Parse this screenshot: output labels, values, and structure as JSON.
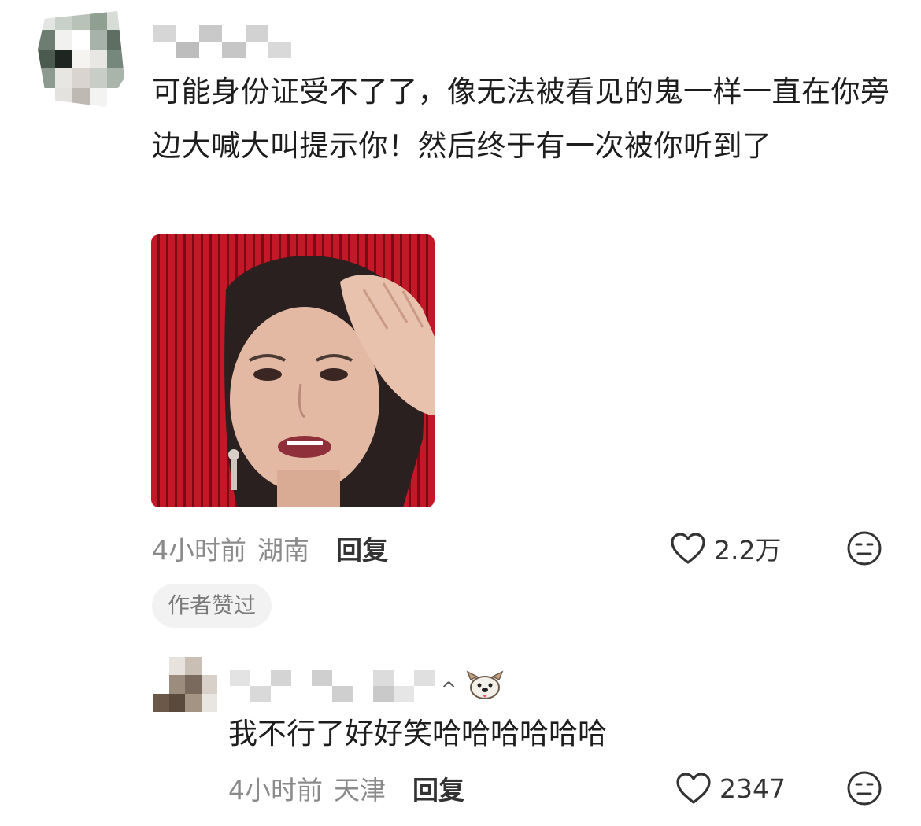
{
  "colors": {
    "text_primary": "#1d1d1d",
    "text_meta": "#8a8a8a",
    "reply_link": "#333333",
    "badge_bg": "#f2f2f2",
    "photo_red": "#c21828"
  },
  "comment": {
    "avatar_icon": "pixelated-avatar",
    "username_icon": "pixelated-username",
    "text": "可能身份证受不了了，像无法被看见的鬼一样一直在你旁边大喊大叫提示你！然后终于有一次被你听到了",
    "image_icon": "meme-photo",
    "time": "4小时前",
    "location": "湖南",
    "reply_label": "回复",
    "like_icon": "heart-outline-icon",
    "like_count": "2.2万",
    "dislike_icon": "unamused-face-icon",
    "badge": "作者赞过"
  },
  "reply": {
    "avatar_icon": "pixelated-avatar",
    "username_icon": "pixelated-username",
    "caret": "^",
    "badge_icon": "dog-face-icon",
    "text": "我不行了好好笑哈哈哈哈哈哈",
    "time": "4小时前",
    "location": "天津",
    "reply_label": "回复",
    "like_icon": "heart-outline-icon",
    "like_count": "2347",
    "dislike_icon": "unamused-face-icon"
  }
}
